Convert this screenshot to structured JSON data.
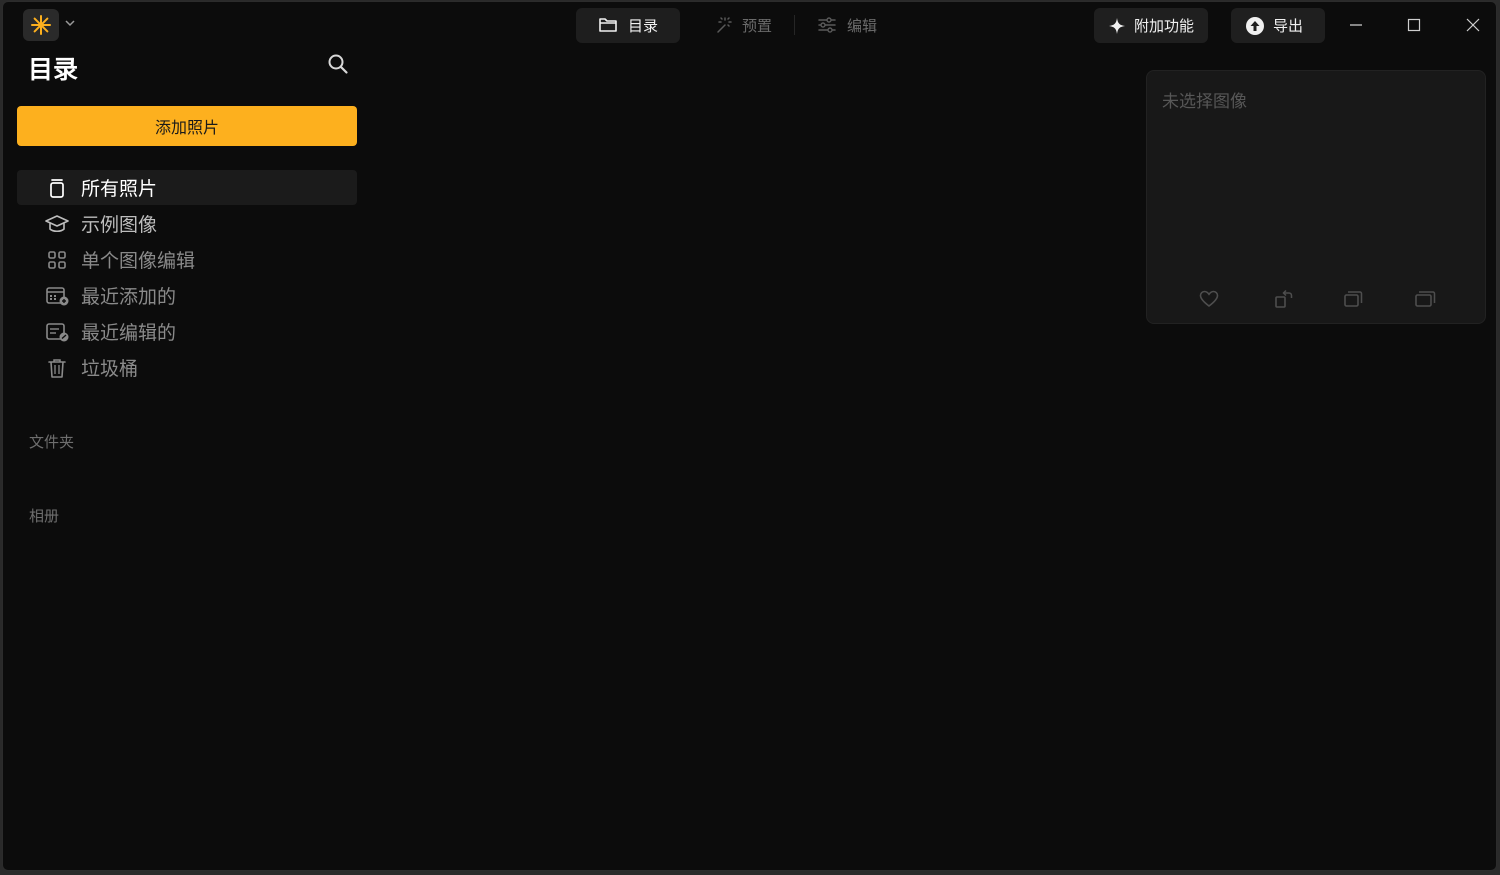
{
  "topbar": {
    "tabs": [
      {
        "label": "目录",
        "icon": "folder-icon",
        "active": true
      },
      {
        "label": "预置",
        "icon": "magic-wand-icon",
        "active": false
      },
      {
        "label": "编辑",
        "icon": "sliders-icon",
        "active": false
      }
    ],
    "addons_label": "附加功能",
    "export_label": "导出"
  },
  "sidebar": {
    "title": "目录",
    "add_photos_label": "添加照片",
    "items": [
      {
        "label": "所有照片",
        "icon": "photos-stack-icon",
        "active": true
      },
      {
        "label": "示例图像",
        "icon": "graduation-cap-icon"
      },
      {
        "label": "单个图像编辑",
        "icon": "grid-icon"
      },
      {
        "label": "最近添加的",
        "icon": "recently-added-icon"
      },
      {
        "label": "最近编辑的",
        "icon": "recently-edited-icon"
      },
      {
        "label": "垃圾桶",
        "icon": "trash-icon"
      }
    ],
    "folders_label": "文件夹",
    "albums_label": "相册"
  },
  "info_panel": {
    "no_selection_text": "未选择图像",
    "actions": [
      "heart-icon",
      "rotate-icon",
      "copy-icon",
      "paste-icon"
    ]
  },
  "colors": {
    "accent": "#fdb01e",
    "background": "#0c0c0c"
  }
}
